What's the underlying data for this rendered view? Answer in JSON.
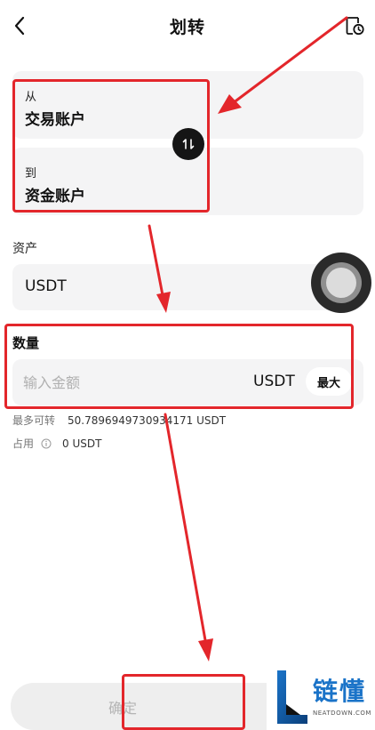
{
  "header": {
    "title": "划转",
    "back_icon": "chevron-left-icon",
    "history_icon": "document-clock-icon"
  },
  "transfer": {
    "from_label": "从",
    "from_account": "交易账户",
    "to_label": "到",
    "to_account": "资金账户",
    "swap_icon": "swap-vertical-icon"
  },
  "asset": {
    "label": "资产",
    "value": "USDT"
  },
  "amount": {
    "label": "数量",
    "placeholder": "输入金额",
    "value": "",
    "unit": "USDT",
    "max_label": "最大"
  },
  "info": {
    "max_transferable_label": "最多可转",
    "max_transferable_value": "50.7896949730934171 USDT",
    "used_label": "占用",
    "used_value": "0 USDT"
  },
  "actions": {
    "confirm_label": "确定"
  },
  "watermark": {
    "brand": "链懂",
    "site": "NEATDOWN.COM"
  },
  "colors": {
    "annotation": "#e3262b",
    "field_bg": "#f4f4f5",
    "watermark_blue": "#1a73c8"
  }
}
